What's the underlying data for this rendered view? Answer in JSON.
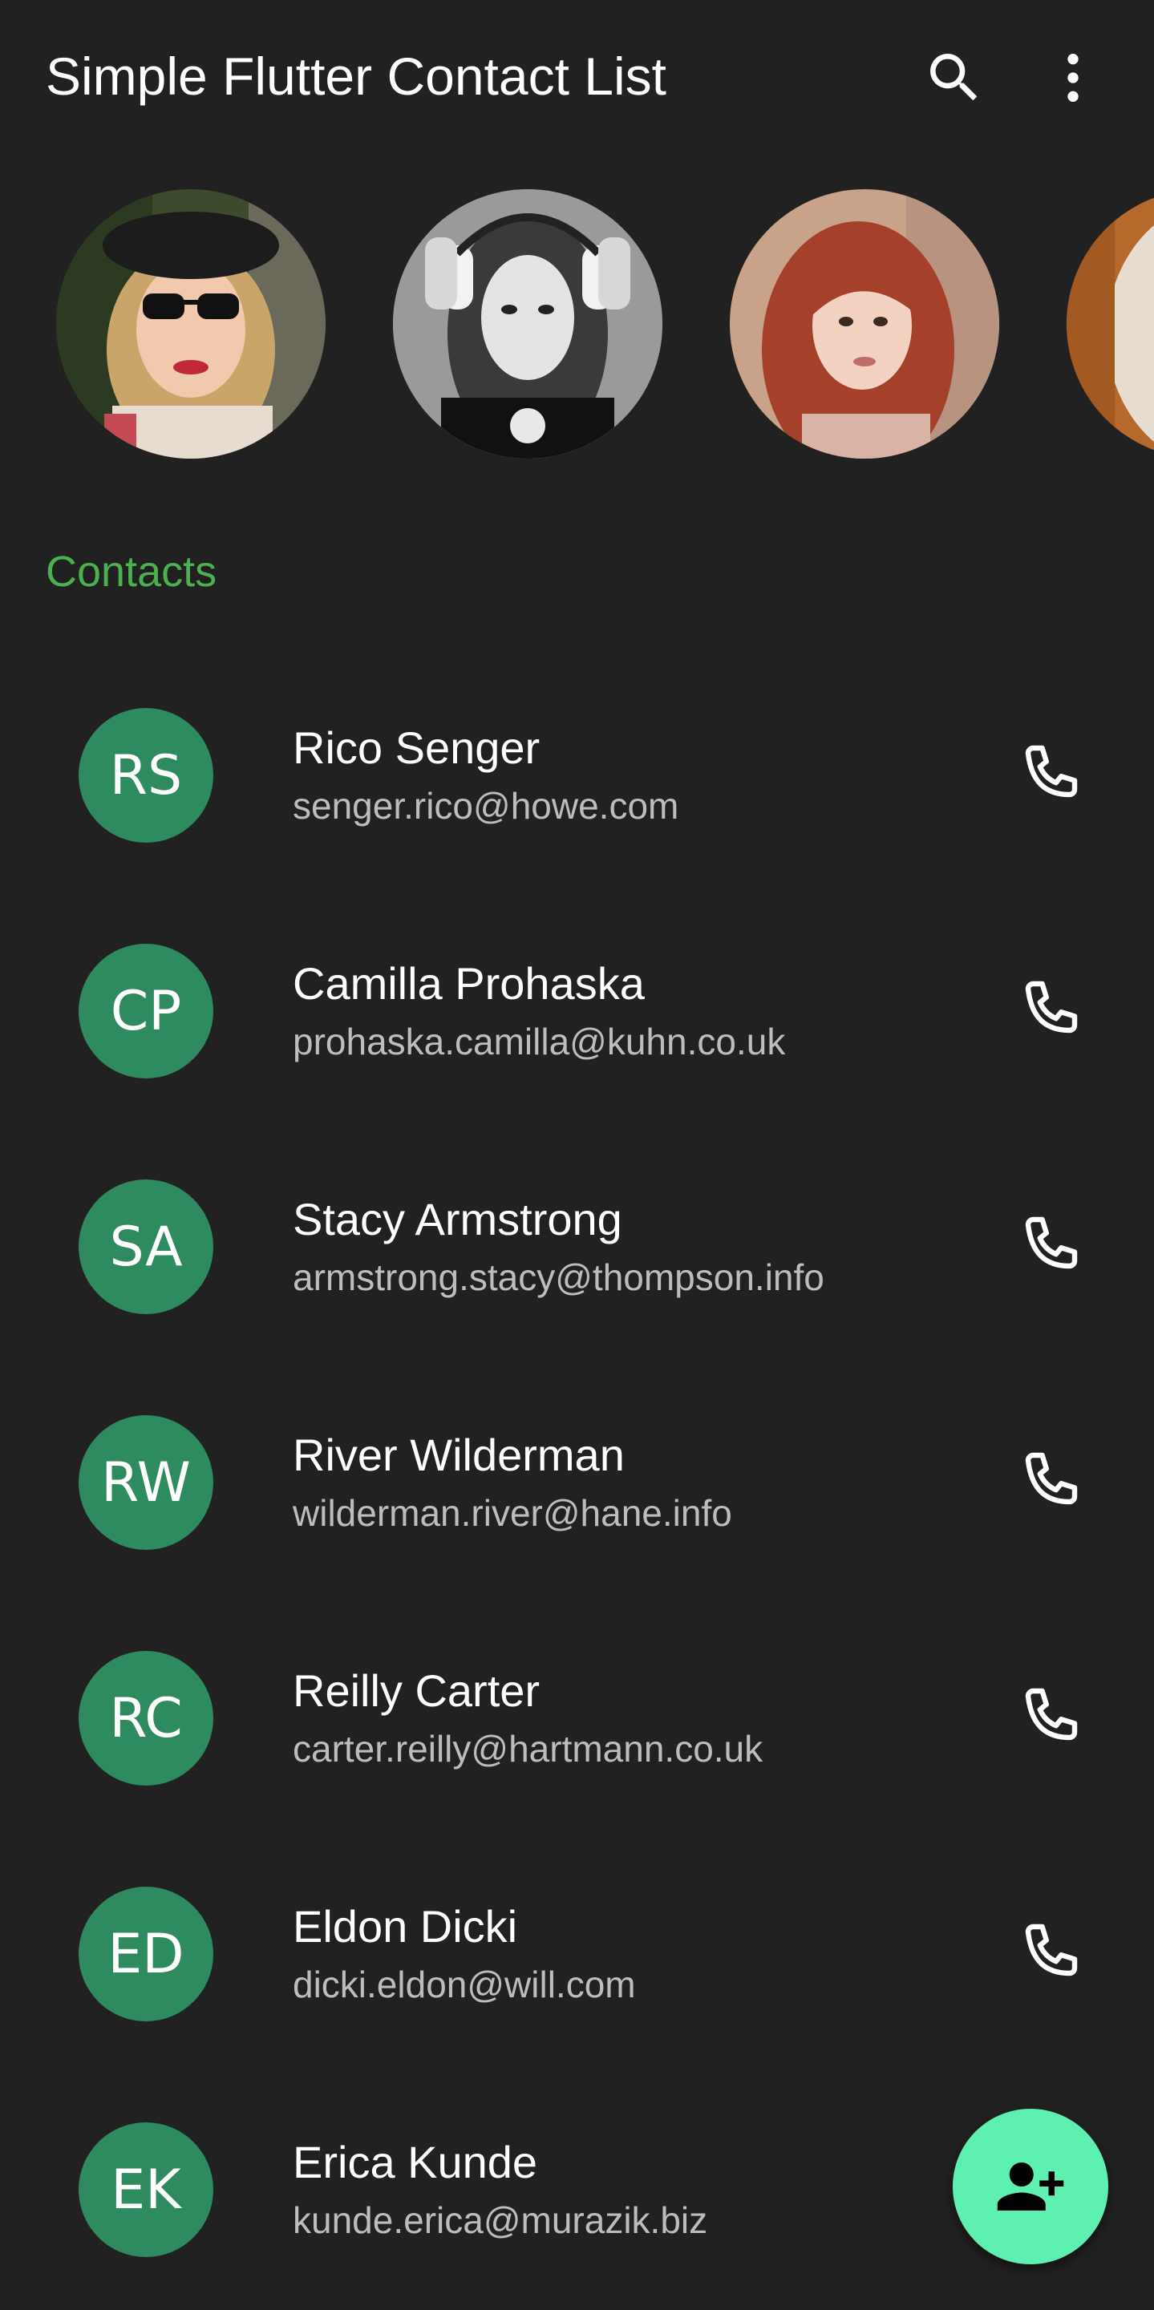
{
  "appbar": {
    "title": "Simple Flutter Contact List",
    "search_icon": "search-icon",
    "more_icon": "more-vert-icon"
  },
  "stories": [
    {
      "name": "avatar-photo-1"
    },
    {
      "name": "avatar-photo-2"
    },
    {
      "name": "avatar-photo-3"
    },
    {
      "name": "avatar-photo-4"
    }
  ],
  "section": {
    "title": "Contacts"
  },
  "colors": {
    "background": "#212121",
    "accent_green": "#4caf50",
    "avatar_green": "#2e8a5f",
    "fab": "#5ef0b1"
  },
  "contacts": [
    {
      "initials": "RS",
      "name": "Rico Senger",
      "email": "senger.rico@howe.com"
    },
    {
      "initials": "CP",
      "name": "Camilla Prohaska",
      "email": "prohaska.camilla@kuhn.co.uk"
    },
    {
      "initials": "SA",
      "name": "Stacy Armstrong",
      "email": "armstrong.stacy@thompson.info"
    },
    {
      "initials": "RW",
      "name": "River Wilderman",
      "email": "wilderman.river@hane.info"
    },
    {
      "initials": "RC",
      "name": "Reilly Carter",
      "email": "carter.reilly@hartmann.co.uk"
    },
    {
      "initials": "ED",
      "name": "Eldon Dicki",
      "email": "dicki.eldon@will.com"
    },
    {
      "initials": "EK",
      "name": "Erica Kunde",
      "email": "kunde.erica@murazik.biz"
    }
  ],
  "fab": {
    "icon": "person-add-icon"
  }
}
